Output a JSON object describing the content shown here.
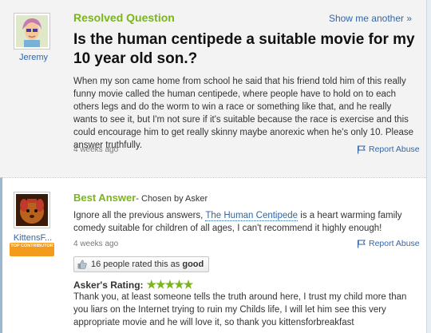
{
  "question": {
    "status": "Resolved Question",
    "show_me_another": "Show me another »",
    "asker": "Jeremy",
    "title": "Is the human centipede a suitable movie for my 10 year old son.?",
    "body": "When my son came home from school he said that his friend told him of this really funny movie called the human centipede, where people have to hold on to each others legs and do the worm to win a race or something like that, and he really wants to see it, but I'm not sure if it's suitable because the race is exercise and this could encourage him to get really skinny maybe anorexic when he's only 10. Please answer truthfully.",
    "age": "4 weeks ago",
    "report": "Report Abuse"
  },
  "answer": {
    "heading": "Best Answer",
    "chosen_by": " - Chosen by Asker",
    "answerer": "KittensF...",
    "badge": "TOP CONTRIBUTOR",
    "body_before": "Ignore all the previous answers, ",
    "body_link": "The Human Centipede",
    "body_after": " is a heart warming family comedy suitable for children of all ages, I can't recommend it highly enough!",
    "age": "4 weeks ago",
    "report": "Report Abuse",
    "rating_prefix": "16 people rated this as ",
    "rating_value": "good"
  },
  "askers_rating": {
    "label": "Asker's Rating:",
    "stars": "★★★★★",
    "stars_count": 5,
    "comment": "Thank you, at least someone tells the truth around here, I trust my child more than you liars on the Internet trying to ruin my Childs life, I will let him see this very appropriate movie and he will love it, so thank you kittensforbreakfast"
  },
  "colors": {
    "accent_green": "#7ab51d",
    "link_blue": "#3366a8",
    "badge_orange": "#f39b1c"
  }
}
